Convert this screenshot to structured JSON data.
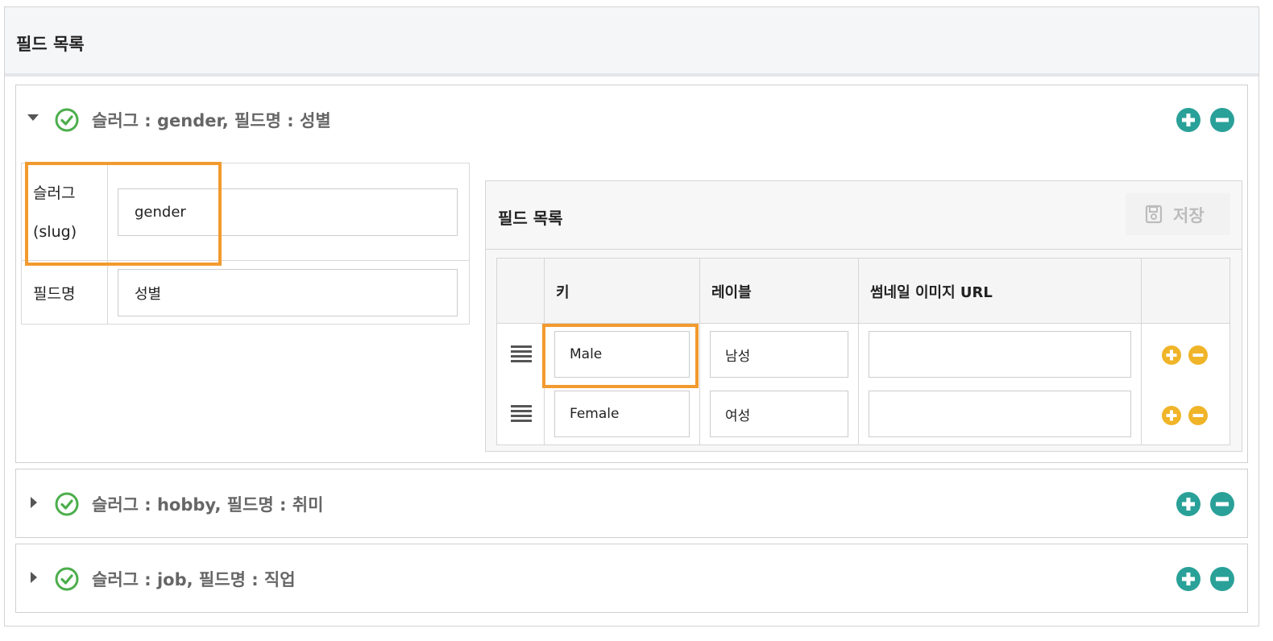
{
  "header": {
    "title": "필드 목록"
  },
  "colors": {
    "teal": "#2aa198",
    "green": "#4cae4c",
    "yellow": "#f0b429",
    "highlight": "#f29a2e"
  },
  "panels": [
    {
      "title": "슬러그 : gender, 필드명 : 성별",
      "expanded": true
    },
    {
      "title": "슬러그 : hobby, 필드명 : 취미",
      "expanded": false
    },
    {
      "title": "슬러그 : job, 필드명 : 직업",
      "expanded": false
    }
  ],
  "form": {
    "slug_label_line1": "슬러그",
    "slug_label_line2": "(slug)",
    "slug_value": "gender",
    "name_label": "필드명",
    "name_value": "성별"
  },
  "subpanel": {
    "title": "필드 목록",
    "save_label": "저장",
    "columns": {
      "key": "키",
      "label": "레이블",
      "thumbnail": "썸네일 이미지 URL"
    },
    "rows": [
      {
        "key": "Male",
        "label": "남성",
        "thumbnail": ""
      },
      {
        "key": "Female",
        "label": "여성",
        "thumbnail": ""
      }
    ]
  }
}
